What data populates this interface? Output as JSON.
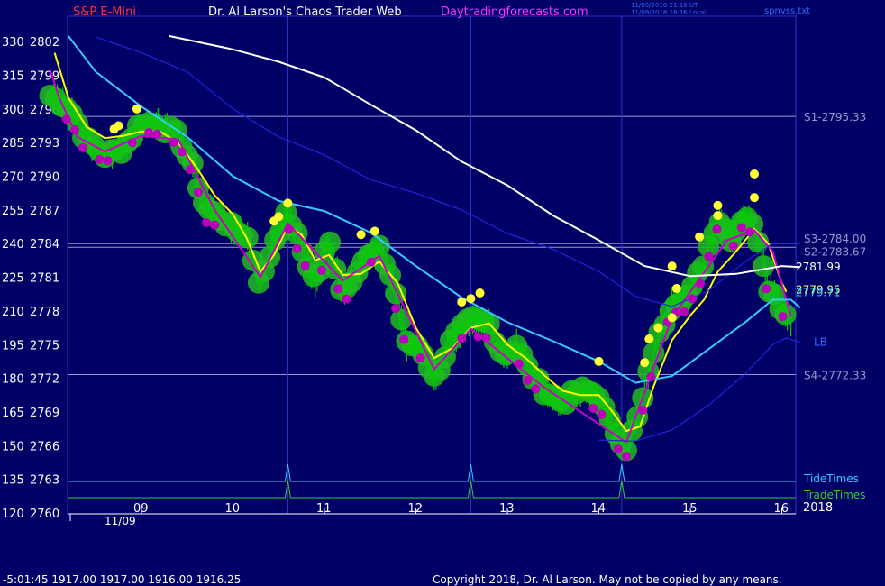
{
  "header": {
    "instrument": "S&P E-Mini",
    "site_title": "Dr. Al Larson's Chaos Trader Web",
    "brand": "Daytradingforecasts.com",
    "stamp_line1": "11/09/2018 21:16 UT",
    "stamp_line2": "11/09/2018 16:16 Local",
    "chart_file": "spnvss.txt"
  },
  "footer": {
    "quote": "-5:01:45  1917.00 1917.00 1916.00 1916.25",
    "copyright": "Copyright 2018, Dr. Al Larson. May not be copied by any means."
  },
  "colors": {
    "background": "#000066",
    "grid_line": "#9999cc",
    "vertical_line": "#3333cc",
    "price_bar": "#00cc00",
    "halo": "#22bb22",
    "yellow_line": "#ffff00",
    "magenta_line": "#cc00cc",
    "cyan_line": "#33ccff",
    "blue_line": "#2222dd",
    "white_line": "#ffffff",
    "yellow_dot": "#ffff33",
    "magenta_dot": "#bb00bb"
  },
  "chart_data": {
    "type": "line",
    "x_tick_labels": [
      "09",
      "10",
      "11",
      "12",
      "13",
      "14",
      "15",
      "16"
    ],
    "date_label": "11/09",
    "year_label": "2018",
    "ylim": [
      2760,
      2803
    ],
    "y_ticks_price": [
      2802,
      2799,
      2796,
      2793,
      2790,
      2787,
      2784,
      2781,
      2778,
      2775,
      2772,
      2769,
      2766,
      2763,
      2760
    ],
    "y_ticks_left": [
      330,
      315,
      300,
      285,
      270,
      255,
      240,
      225,
      210,
      195,
      180,
      165,
      150,
      135,
      120
    ],
    "level_lines": [
      {
        "label": "S1-2795.33",
        "value": 2795.33
      },
      {
        "label": "S3-2784.00",
        "value": 2784.0
      },
      {
        "label": "S2-2783.67",
        "value": 2783.67
      },
      {
        "label": "S4-2772.33",
        "value": 2772.33
      }
    ],
    "tide_times": {
      "label": "TideTimes",
      "hours": [
        10.6,
        12.6,
        14.25
      ]
    },
    "trade_times": {
      "label": "TradeTimes",
      "hours": [
        10.6,
        12.6,
        14.25
      ]
    },
    "right_labels": [
      {
        "text": "2781.99",
        "value": 2781.99
      },
      {
        "text": "2779.95",
        "value": 2779.95
      },
      {
        "text": "2779.71",
        "value": 2779.71
      },
      {
        "text": "LB",
        "value": 2775.3
      }
    ],
    "price_series": [
      {
        "h": 8.0,
        "p": 2797.2
      },
      {
        "h": 8.2,
        "p": 2796.2
      },
      {
        "h": 8.4,
        "p": 2793.2
      },
      {
        "h": 8.6,
        "p": 2791.9
      },
      {
        "h": 8.8,
        "p": 2792.5
      },
      {
        "h": 9.0,
        "p": 2794.8
      },
      {
        "h": 9.2,
        "p": 2794.6
      },
      {
        "h": 9.4,
        "p": 2793.6
      },
      {
        "h": 9.55,
        "p": 2791.0
      },
      {
        "h": 9.7,
        "p": 2787.2
      },
      {
        "h": 9.85,
        "p": 2786.4
      },
      {
        "h": 10.0,
        "p": 2785.3
      },
      {
        "h": 10.15,
        "p": 2784.8
      },
      {
        "h": 10.3,
        "p": 2780.2
      },
      {
        "h": 10.45,
        "p": 2784.3
      },
      {
        "h": 10.6,
        "p": 2786.7
      },
      {
        "h": 10.75,
        "p": 2783.5
      },
      {
        "h": 10.9,
        "p": 2780.6
      },
      {
        "h": 11.05,
        "p": 2784.3
      },
      {
        "h": 11.2,
        "p": 2779.5
      },
      {
        "h": 11.4,
        "p": 2782.4
      },
      {
        "h": 11.6,
        "p": 2783.4
      },
      {
        "h": 11.75,
        "p": 2780.7
      },
      {
        "h": 11.9,
        "p": 2775.0
      },
      {
        "h": 12.05,
        "p": 2774.9
      },
      {
        "h": 12.2,
        "p": 2772.0
      },
      {
        "h": 12.4,
        "p": 2775.5
      },
      {
        "h": 12.6,
        "p": 2777.2
      },
      {
        "h": 12.8,
        "p": 2776.8
      },
      {
        "h": 12.95,
        "p": 2774.0
      },
      {
        "h": 13.1,
        "p": 2775.0
      },
      {
        "h": 13.25,
        "p": 2772.4
      },
      {
        "h": 13.4,
        "p": 2771.0
      },
      {
        "h": 13.6,
        "p": 2769.9
      },
      {
        "h": 13.8,
        "p": 2770.9
      },
      {
        "h": 14.0,
        "p": 2770.6
      },
      {
        "h": 14.1,
        "p": 2768.2
      },
      {
        "h": 14.3,
        "p": 2765.9
      },
      {
        "h": 14.45,
        "p": 2769.0
      },
      {
        "h": 14.6,
        "p": 2774.5
      },
      {
        "h": 14.8,
        "p": 2778.8
      },
      {
        "h": 15.0,
        "p": 2779.5
      },
      {
        "h": 15.15,
        "p": 2782.5
      },
      {
        "h": 15.3,
        "p": 2786.3
      },
      {
        "h": 15.45,
        "p": 2784.5
      },
      {
        "h": 15.6,
        "p": 2786.8
      },
      {
        "h": 15.75,
        "p": 2784.3
      },
      {
        "h": 15.85,
        "p": 2780.3
      },
      {
        "h": 16.0,
        "p": 2778.3
      },
      {
        "h": 16.1,
        "p": 2777.0
      }
    ],
    "series": [
      {
        "color_key": "yellow_line",
        "points": [
          {
            "h": 8.05,
            "p": 2801.0
          },
          {
            "h": 8.2,
            "p": 2797.0
          },
          {
            "h": 8.4,
            "p": 2794.4
          },
          {
            "h": 8.6,
            "p": 2793.4
          },
          {
            "h": 8.8,
            "p": 2793.6
          },
          {
            "h": 9.0,
            "p": 2794.0
          },
          {
            "h": 9.2,
            "p": 2794.0
          },
          {
            "h": 9.4,
            "p": 2793.0
          },
          {
            "h": 9.6,
            "p": 2790.8
          },
          {
            "h": 9.8,
            "p": 2788.3
          },
          {
            "h": 10.0,
            "p": 2786.6
          },
          {
            "h": 10.15,
            "p": 2784.5
          },
          {
            "h": 10.3,
            "p": 2781.5
          },
          {
            "h": 10.45,
            "p": 2783.0
          },
          {
            "h": 10.6,
            "p": 2785.6
          },
          {
            "h": 10.75,
            "p": 2784.8
          },
          {
            "h": 10.9,
            "p": 2782.5
          },
          {
            "h": 11.05,
            "p": 2783.0
          },
          {
            "h": 11.2,
            "p": 2781.2
          },
          {
            "h": 11.4,
            "p": 2781.3
          },
          {
            "h": 11.6,
            "p": 2782.4
          },
          {
            "h": 11.8,
            "p": 2780.5
          },
          {
            "h": 12.0,
            "p": 2776.5
          },
          {
            "h": 12.2,
            "p": 2773.8
          },
          {
            "h": 12.4,
            "p": 2774.7
          },
          {
            "h": 12.6,
            "p": 2776.5
          },
          {
            "h": 12.8,
            "p": 2776.9
          },
          {
            "h": 13.0,
            "p": 2775.0
          },
          {
            "h": 13.2,
            "p": 2773.8
          },
          {
            "h": 13.4,
            "p": 2772.3
          },
          {
            "h": 13.6,
            "p": 2770.9
          },
          {
            "h": 13.8,
            "p": 2770.5
          },
          {
            "h": 14.0,
            "p": 2770.5
          },
          {
            "h": 14.15,
            "p": 2769.0
          },
          {
            "h": 14.3,
            "p": 2767.3
          },
          {
            "h": 14.45,
            "p": 2767.7
          },
          {
            "h": 14.6,
            "p": 2771.3
          },
          {
            "h": 14.8,
            "p": 2775.4
          },
          {
            "h": 15.0,
            "p": 2777.6
          },
          {
            "h": 15.15,
            "p": 2779.0
          },
          {
            "h": 15.3,
            "p": 2781.5
          },
          {
            "h": 15.5,
            "p": 2783.3
          },
          {
            "h": 15.7,
            "p": 2785.3
          },
          {
            "h": 15.85,
            "p": 2784.0
          },
          {
            "h": 16.0,
            "p": 2780.5
          },
          {
            "h": 16.05,
            "p": 2779.7
          }
        ]
      },
      {
        "color_key": "magenta_line",
        "points": [
          {
            "h": 8.0,
            "p": 2799.5
          },
          {
            "h": 8.1,
            "p": 2797.0
          },
          {
            "h": 8.3,
            "p": 2793.5
          },
          {
            "h": 8.6,
            "p": 2792.2
          },
          {
            "h": 9.0,
            "p": 2793.6
          },
          {
            "h": 9.4,
            "p": 2793.3
          },
          {
            "h": 9.8,
            "p": 2787.0
          },
          {
            "h": 10.3,
            "p": 2781.0
          },
          {
            "h": 10.6,
            "p": 2785.8
          },
          {
            "h": 11.2,
            "p": 2780.7
          },
          {
            "h": 11.6,
            "p": 2782.9
          },
          {
            "h": 12.2,
            "p": 2772.8
          },
          {
            "h": 12.6,
            "p": 2776.4
          },
          {
            "h": 13.4,
            "p": 2771.2
          },
          {
            "h": 14.3,
            "p": 2766.3
          },
          {
            "h": 14.8,
            "p": 2777.4
          },
          {
            "h": 15.4,
            "p": 2784.3
          },
          {
            "h": 15.7,
            "p": 2785.2
          },
          {
            "h": 15.9,
            "p": 2783.3
          },
          {
            "h": 16.1,
            "p": 2777.5
          }
        ]
      },
      {
        "color_key": "cyan_line",
        "points": [
          {
            "h": 8.2,
            "p": 2802.5
          },
          {
            "h": 8.5,
            "p": 2799.3
          },
          {
            "h": 9.0,
            "p": 2796.2
          },
          {
            "h": 9.5,
            "p": 2793.5
          },
          {
            "h": 10.0,
            "p": 2790.0
          },
          {
            "h": 10.5,
            "p": 2787.8
          },
          {
            "h": 11.0,
            "p": 2786.9
          },
          {
            "h": 11.5,
            "p": 2785.0
          },
          {
            "h": 12.0,
            "p": 2782.0
          },
          {
            "h": 12.5,
            "p": 2779.2
          },
          {
            "h": 13.0,
            "p": 2777.0
          },
          {
            "h": 13.5,
            "p": 2775.3
          },
          {
            "h": 14.0,
            "p": 2773.5
          },
          {
            "h": 14.4,
            "p": 2771.6
          },
          {
            "h": 14.8,
            "p": 2772.2
          },
          {
            "h": 15.2,
            "p": 2774.6
          },
          {
            "h": 15.6,
            "p": 2777.0
          },
          {
            "h": 15.9,
            "p": 2779.0
          },
          {
            "h": 16.1,
            "p": 2779.0
          },
          {
            "h": 16.2,
            "p": 2778.3
          }
        ]
      },
      {
        "color_key": "blue_line",
        "points": [
          {
            "h": 8.5,
            "p": 2802.4
          },
          {
            "h": 9.0,
            "p": 2801.0
          },
          {
            "h": 9.5,
            "p": 2799.3
          },
          {
            "h": 10.0,
            "p": 2796.0
          },
          {
            "h": 10.5,
            "p": 2793.5
          },
          {
            "h": 11.0,
            "p": 2791.9
          },
          {
            "h": 11.5,
            "p": 2789.7
          },
          {
            "h": 12.0,
            "p": 2788.5
          },
          {
            "h": 12.5,
            "p": 2787.0
          },
          {
            "h": 13.0,
            "p": 2784.9
          },
          {
            "h": 13.5,
            "p": 2783.5
          },
          {
            "h": 14.0,
            "p": 2781.5
          },
          {
            "h": 14.4,
            "p": 2779.3
          },
          {
            "h": 14.8,
            "p": 2778.4
          },
          {
            "h": 15.2,
            "p": 2779.8
          },
          {
            "h": 15.6,
            "p": 2782.4
          },
          {
            "h": 15.9,
            "p": 2784.0
          },
          {
            "h": 16.2,
            "p": 2784.0
          }
        ]
      },
      {
        "color_key": "blue_line",
        "points": [
          {
            "h": 14.0,
            "p": 2766.5
          },
          {
            "h": 14.4,
            "p": 2766.4
          },
          {
            "h": 14.8,
            "p": 2767.4
          },
          {
            "h": 15.2,
            "p": 2769.6
          },
          {
            "h": 15.6,
            "p": 2772.4
          },
          {
            "h": 15.9,
            "p": 2775.0
          },
          {
            "h": 16.05,
            "p": 2775.6
          },
          {
            "h": 16.2,
            "p": 2775.2
          }
        ]
      },
      {
        "color_key": "white_line",
        "points": [
          {
            "h": 9.3,
            "p": 2802.5
          },
          {
            "h": 10.0,
            "p": 2801.3
          },
          {
            "h": 10.5,
            "p": 2800.2
          },
          {
            "h": 11.0,
            "p": 2798.8
          },
          {
            "h": 11.5,
            "p": 2796.4
          },
          {
            "h": 12.0,
            "p": 2794.1
          },
          {
            "h": 12.5,
            "p": 2791.3
          },
          {
            "h": 13.0,
            "p": 2789.2
          },
          {
            "h": 13.5,
            "p": 2786.5
          },
          {
            "h": 14.0,
            "p": 2784.3
          },
          {
            "h": 14.5,
            "p": 2782.0
          },
          {
            "h": 15.0,
            "p": 2781.1
          },
          {
            "h": 15.5,
            "p": 2781.3
          },
          {
            "h": 16.0,
            "p": 2782.0
          },
          {
            "h": 16.2,
            "p": 2781.9
          }
        ]
      }
    ],
    "yellow_dots": [
      {
        "h": 8.7,
        "p": 2794.2
      },
      {
        "h": 8.75,
        "p": 2794.5
      },
      {
        "h": 8.95,
        "p": 2796.0
      },
      {
        "h": 10.45,
        "p": 2786.0
      },
      {
        "h": 10.5,
        "p": 2786.4
      },
      {
        "h": 10.6,
        "p": 2787.6
      },
      {
        "h": 11.4,
        "p": 2784.8
      },
      {
        "h": 11.55,
        "p": 2785.1
      },
      {
        "h": 12.5,
        "p": 2778.8
      },
      {
        "h": 12.6,
        "p": 2779.1
      },
      {
        "h": 12.7,
        "p": 2779.6
      },
      {
        "h": 14.0,
        "p": 2773.5
      },
      {
        "h": 14.5,
        "p": 2773.4
      },
      {
        "h": 14.55,
        "p": 2775.5
      },
      {
        "h": 14.65,
        "p": 2776.5
      },
      {
        "h": 14.8,
        "p": 2777.4
      },
      {
        "h": 14.85,
        "p": 2780.0
      },
      {
        "h": 14.8,
        "p": 2782.0
      },
      {
        "h": 15.1,
        "p": 2784.6
      },
      {
        "h": 15.3,
        "p": 2786.5
      },
      {
        "h": 15.3,
        "p": 2787.4
      },
      {
        "h": 15.7,
        "p": 2788.1
      },
      {
        "h": 15.7,
        "p": 2790.2
      }
    ]
  }
}
